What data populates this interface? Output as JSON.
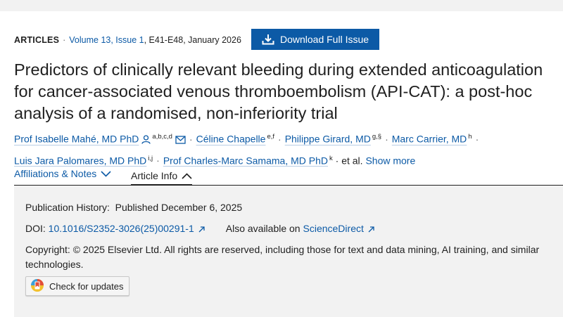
{
  "meta": {
    "type": "ARTICLES",
    "separator": "·",
    "volume": "Volume 13, Issue 1",
    "pages": ", E41-E48, January 2026"
  },
  "download_button": {
    "label": "Download Full Issue",
    "icon": "download-icon"
  },
  "title": "Predictors of clinically relevant bleeding during extended anticoagulation for cancer-associated venous thromboembolism (API-CAT): a post-hoc analysis of a randomised, non-inferiority trial",
  "authors": [
    {
      "name": "Prof Isabelle Mahé, MD PhD",
      "sup": "a,b,c,d"
    },
    {
      "name": "Céline Chapelle",
      "sup": "e,f"
    },
    {
      "name": "Philippe Girard, MD",
      "sup": "g,§"
    },
    {
      "name": "Marc Carrier, MD",
      "sup": "h"
    },
    {
      "name": "Luis Jara Palomares, MD PhD",
      "sup": "i,j"
    },
    {
      "name": "Prof Charles-Marc Samama, MD PhD",
      "sup": "k"
    }
  ],
  "authors_etal": "· et al.",
  "show_more": "Show more",
  "tabs": {
    "affiliations": "Affiliations & Notes",
    "article_info": "Article Info"
  },
  "info": {
    "history_label": "Publication History:",
    "history_value": "Published December 6, 2025",
    "doi_label": "DOI:",
    "doi_value": "10.1016/S2352-3026(25)00291-1",
    "also_label": "Also available on",
    "also_link": "ScienceDirect",
    "copyright": "Copyright: © 2025 Elsevier Ltd. All rights are reserved, including those for text and data mining, AI training, and similar technologies.",
    "check_updates": "Check for updates"
  },
  "colors": {
    "link": "#0c5aa6",
    "button": "#0c5aa6",
    "panel": "#f2f2f2"
  }
}
